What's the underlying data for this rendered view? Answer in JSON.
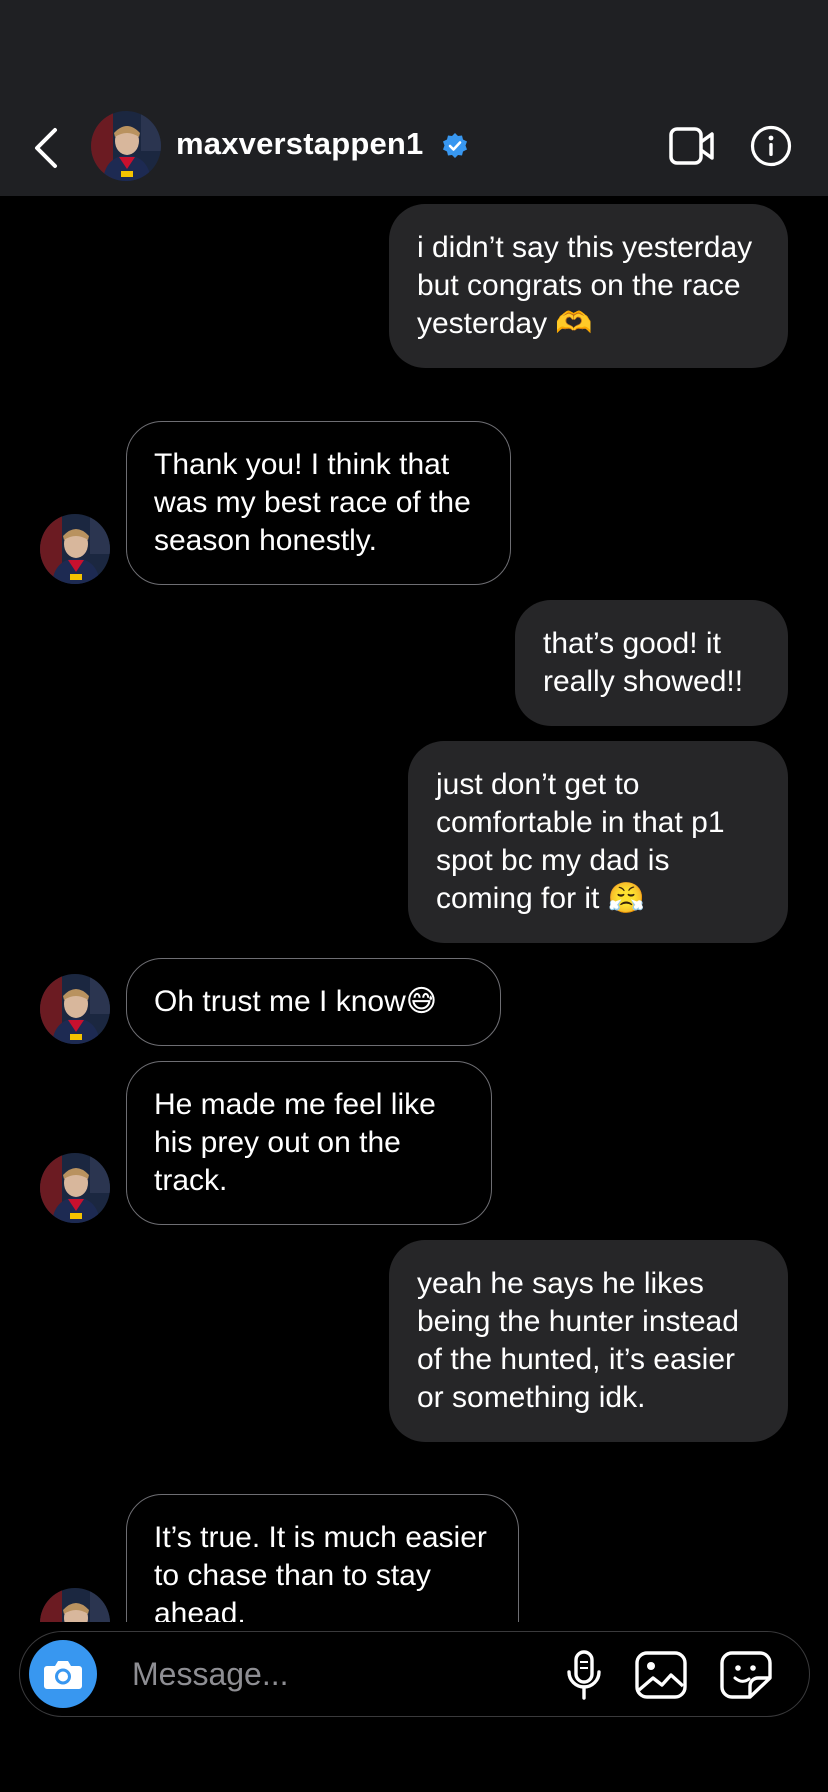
{
  "header": {
    "username": "maxverstappen1",
    "verified_color": "#3897f0"
  },
  "messages": [
    {
      "side": "out",
      "text": "i didn’t say this yesterday but congrats on the race yesterday 🫶"
    },
    {
      "side": "in",
      "text": "Thank you! I think that was my best race of the season honestly."
    },
    {
      "side": "out",
      "text": "that’s good! it really showed!!"
    },
    {
      "side": "out",
      "text": "just don’t get to comfortable in that p1 spot bc my dad is coming for it 😤"
    },
    {
      "side": "in",
      "text": "Oh trust me I know😅"
    },
    {
      "side": "in",
      "text": "He made me feel like his prey out on the track."
    },
    {
      "side": "out",
      "text": "yeah he says he likes being the hunter instead of the hunted, it’s easier or something idk."
    },
    {
      "side": "in",
      "text": "It’s true. It is much easier to chase than to stay ahead."
    }
  ],
  "composer": {
    "placeholder": "Message...",
    "accent": "#3897f0"
  },
  "icons": {
    "back": "chevron-left-icon",
    "video": "video-camera-icon",
    "info": "info-icon",
    "camera": "camera-icon",
    "mic": "microphone-icon",
    "gallery": "image-icon",
    "sticker": "sticker-icon"
  }
}
